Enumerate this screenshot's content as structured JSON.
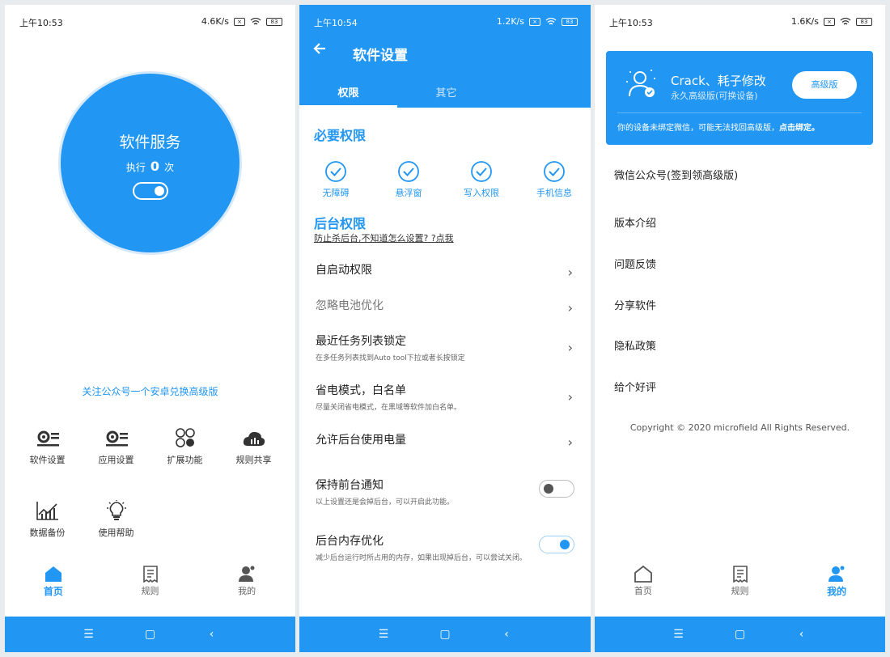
{
  "phone1": {
    "status": {
      "time": "上午10:53",
      "speed": "4.6K/s",
      "battery": "83"
    },
    "service": {
      "title": "软件服务",
      "exec_prefix": "执行",
      "exec_count": "0",
      "exec_suffix": "次"
    },
    "promo": "关注公众号一个安卓兑换高级版",
    "grid": [
      {
        "label": "软件设置",
        "icon": "settings-icon"
      },
      {
        "label": "应用设置",
        "icon": "settings-icon"
      },
      {
        "label": "扩展功能",
        "icon": "extensions-icon"
      },
      {
        "label": "规则共享",
        "icon": "cloud-icon"
      },
      {
        "label": "数据备份",
        "icon": "chart-icon"
      },
      {
        "label": "使用帮助",
        "icon": "lightbulb-icon"
      }
    ],
    "tabs": [
      {
        "label": "首页"
      },
      {
        "label": "规则"
      },
      {
        "label": "我的"
      }
    ]
  },
  "phone2": {
    "status": {
      "time": "上午10:54",
      "speed": "1.2K/s",
      "battery": "83"
    },
    "title": "软件设置",
    "tabs": [
      {
        "label": "权限"
      },
      {
        "label": "其它"
      }
    ],
    "section_required": "必要权限",
    "perms": [
      {
        "label": "无障碍"
      },
      {
        "label": "悬浮窗"
      },
      {
        "label": "写入权限"
      },
      {
        "label": "手机信息"
      }
    ],
    "section_background": "后台权限",
    "bg_link": "防止杀后台,不知道怎么设置? ?点我",
    "rows": [
      {
        "title": "自启动权限",
        "sub": ""
      },
      {
        "title": "忽略电池优化",
        "sub": ""
      },
      {
        "title": "最近任务列表锁定",
        "sub": "在多任务列表找到Auto tool下拉或者长按锁定"
      },
      {
        "title": "省电模式，白名单",
        "sub": "尽量关闭省电模式，在黑域等软件加白名单。"
      },
      {
        "title": "允许后台使用电量",
        "sub": ""
      }
    ],
    "toggles": [
      {
        "title": "保持前台通知",
        "sub": "以上设置还是会掉后台，可以开启此功能。",
        "on": false
      },
      {
        "title": "后台内存优化",
        "sub": "减少后台运行时所占用的内存，如果出现掉后台，可以尝试关闭。",
        "on": true
      }
    ]
  },
  "phone3": {
    "status": {
      "time": "上午10:53",
      "speed": "1.6K/s",
      "battery": "83"
    },
    "card": {
      "name": "Crack、耗子修改",
      "sub": "永久高级版(可换设备)",
      "pro_button": "高级版",
      "note": "你的设备未绑定微信，可能无法找回高级版，",
      "note_link": "点击绑定。"
    },
    "menu": [
      {
        "label": "微信公众号(签到领高级版)"
      },
      {
        "label": "版本介绍"
      },
      {
        "label": "问题反馈"
      },
      {
        "label": "分享软件"
      },
      {
        "label": "隐私政策"
      },
      {
        "label": "给个好评"
      }
    ],
    "copyright": "Copyright © 2020 microfield All Rights Reserved.",
    "tabs": [
      {
        "label": "首页"
      },
      {
        "label": "规则"
      },
      {
        "label": "我的"
      }
    ]
  },
  "navbar": {
    "menu": "☰",
    "home": "▢",
    "back": "‹"
  },
  "colors": {
    "accent": "#2196f3",
    "background": "#ffffff"
  }
}
